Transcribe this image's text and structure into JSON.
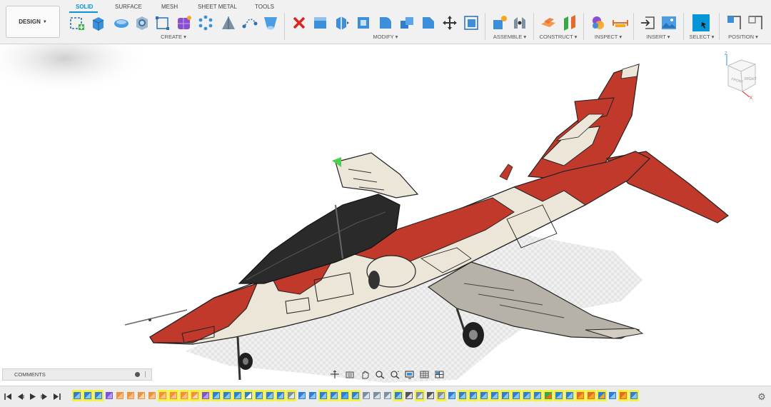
{
  "toolbar": {
    "workspace": "DESIGN",
    "tabs": [
      "SOLID",
      "SURFACE",
      "MESH",
      "SHEET METAL",
      "TOOLS"
    ],
    "active_tab": "SOLID",
    "groups": {
      "create": "CREATE",
      "modify": "MODIFY",
      "assemble": "ASSEMBLE",
      "construct": "CONSTRUCT",
      "inspect": "INSPECT",
      "insert": "INSERT",
      "select": "SELECT",
      "position": "POSITION"
    },
    "icons": {
      "create": [
        "new-sketch-icon",
        "extrude-icon",
        "revolve-icon",
        "hole-icon",
        "rectangular-pattern-icon",
        "create-form-icon",
        "pattern-icon",
        "rib-icon",
        "sweep-icon",
        "loft-icon"
      ],
      "modify": [
        "delete-icon",
        "press-pull-icon",
        "split-body-icon",
        "shell-icon",
        "fillet-icon",
        "combine-icon",
        "chamfer-icon",
        "move-icon",
        "scale-icon"
      ],
      "assemble": [
        "new-component-icon",
        "joint-icon"
      ],
      "construct": [
        "offset-plane-icon",
        "midplane-icon"
      ],
      "inspect": [
        "display-component-colors-icon",
        "measure-icon"
      ],
      "insert": [
        "insert-derive-icon",
        "insert-image-icon"
      ],
      "select": [
        "select-icon"
      ],
      "position": [
        "capture-position-icon",
        "revert-position-icon"
      ]
    },
    "accent": "#0696d7"
  },
  "viewcube": {
    "front_label": "FRONT",
    "right_label": "RIGHT",
    "axis_x": "X",
    "axis_z": "Z"
  },
  "comments": {
    "label": "COMMENTS"
  },
  "navbar": {
    "icons": [
      "orbit-icon",
      "look-at-icon",
      "pan-icon",
      "zoom-icon",
      "fit-icon",
      "display-settings-icon",
      "grid-settings-icon",
      "viewports-icon"
    ]
  },
  "timeline": {
    "controls": [
      "go-to-start-icon",
      "step-back-icon",
      "play-icon",
      "step-forward-icon",
      "go-to-end-icon"
    ],
    "features": [
      "sketch",
      "sketch",
      "sketch",
      "body",
      "extrude",
      "extrude",
      "sketch-line",
      "extrude",
      "extrude",
      "extrude",
      "extrude",
      "sketch-line",
      "body",
      "sketch",
      "sketch",
      "sketch",
      "spline",
      "sketch",
      "sketch",
      "sketch",
      "fillet",
      "sketch",
      "sketch",
      "sketch",
      "sketch",
      "combine",
      "sketch",
      "fillet",
      "fillet",
      "fillet",
      "sketch",
      "move",
      "fillet",
      "move",
      "chamfer",
      "sketch",
      "sketch",
      "sketch",
      "sketch",
      "sketch",
      "sketch",
      "sketch",
      "sketch",
      "sketch",
      "appearance",
      "sketch",
      "sketch",
      "paint",
      "paint",
      "component",
      "sketch",
      "paint",
      "sketch"
    ],
    "selected": [
      0,
      1,
      2,
      8,
      9,
      10,
      11,
      12,
      13,
      14,
      15,
      16,
      17,
      18,
      19,
      20,
      23,
      24,
      25,
      26,
      30,
      32,
      34,
      36,
      37,
      38,
      39,
      40,
      41,
      42,
      43,
      44,
      45,
      46,
      47,
      48,
      49,
      51,
      52,
      53,
      54,
      55,
      56
    ]
  },
  "colors": {
    "body_red": "#c0392b",
    "body_cream": "#ece6d9",
    "canopy": "#2a2a2a",
    "timeline_highlight": "#f7f13a"
  }
}
